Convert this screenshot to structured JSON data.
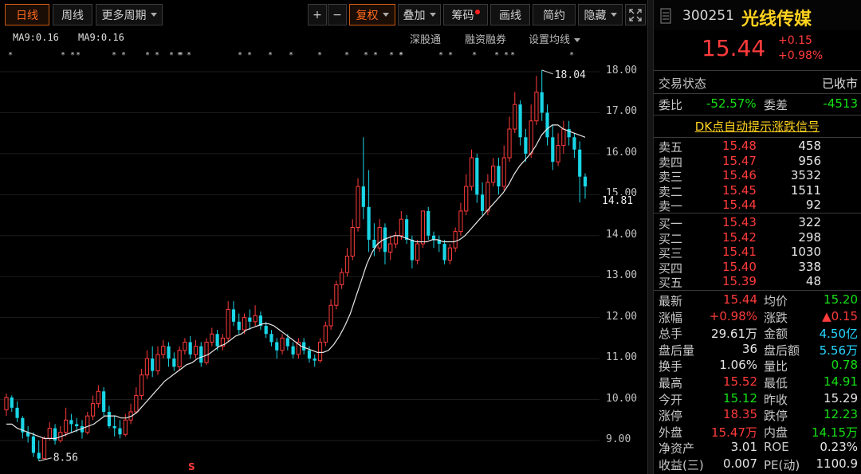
{
  "toolbar": {
    "day": "日线",
    "week": "周线",
    "more": "更多周期",
    "plus": "+",
    "minus": "−",
    "fuquan": "复权",
    "overlay": "叠加",
    "chip": "筹码",
    "draw": "画线",
    "simple": "简约",
    "hide": "隐藏",
    "fullscreen_icon": "fullscreen-icon"
  },
  "ma_legend": {
    "left": "MA9:0.16",
    "right": "MA9:0.16"
  },
  "sub_toolbar": {
    "a": "深股通",
    "b": "融资融券",
    "c": "设置均线"
  },
  "stars": [
    "*",
    "* *",
    "*",
    "* *",
    "* *",
    "* *",
    "* *",
    "* *",
    "*",
    "*",
    "*",
    "*",
    "* *",
    "* *",
    "*",
    "* *",
    "*",
    "* *",
    "*",
    "*"
  ],
  "chart_data": {
    "type": "candlestick",
    "y_ticks": [
      "18.00",
      "17.00",
      "16.00",
      "15.00",
      "14.00",
      "13.00",
      "12.00",
      "11.00",
      "10.00",
      "9.00"
    ],
    "ylim": [
      8.4,
      18.35
    ],
    "price_marker": "14.81",
    "annotations": {
      "high_label": "18.04",
      "low_label": "8.56",
      "signal": "S"
    },
    "candles": [
      [
        9.75,
        10.05,
        9.6,
        10.15
      ],
      [
        10.05,
        9.8,
        9.7,
        10.1
      ],
      [
        9.8,
        9.55,
        9.45,
        9.95
      ],
      [
        9.55,
        9.2,
        9.05,
        9.6
      ],
      [
        9.2,
        9.1,
        8.95,
        9.35
      ],
      [
        9.1,
        8.7,
        8.6,
        9.2
      ],
      [
        8.7,
        8.56,
        8.5,
        9.0
      ],
      [
        8.56,
        9.05,
        8.55,
        9.1
      ],
      [
        9.05,
        9.3,
        9.0,
        9.45
      ],
      [
        9.3,
        9.0,
        8.9,
        9.4
      ],
      [
        9.0,
        9.2,
        8.95,
        9.35
      ],
      [
        9.2,
        9.5,
        9.1,
        9.8
      ],
      [
        9.5,
        9.4,
        9.2,
        9.65
      ],
      [
        9.4,
        9.35,
        9.2,
        9.55
      ],
      [
        9.35,
        9.2,
        9.05,
        9.5
      ],
      [
        9.2,
        9.6,
        9.15,
        9.7
      ],
      [
        9.6,
        9.9,
        9.5,
        10.1
      ],
      [
        9.9,
        10.2,
        9.8,
        10.35
      ],
      [
        10.2,
        9.7,
        9.6,
        10.3
      ],
      [
        9.7,
        9.35,
        9.3,
        9.85
      ],
      [
        9.35,
        9.3,
        9.1,
        9.6
      ],
      [
        9.3,
        9.15,
        9.05,
        9.5
      ],
      [
        9.15,
        9.5,
        9.1,
        9.65
      ],
      [
        9.5,
        9.7,
        9.4,
        9.9
      ],
      [
        9.7,
        10.1,
        9.65,
        10.3
      ],
      [
        10.1,
        10.6,
        10.0,
        10.75
      ],
      [
        10.6,
        11.0,
        10.5,
        11.2
      ],
      [
        11.0,
        10.7,
        10.55,
        11.3
      ],
      [
        10.7,
        11.1,
        10.6,
        11.3
      ],
      [
        11.1,
        11.3,
        11.0,
        11.45
      ],
      [
        11.3,
        11.0,
        10.8,
        11.4
      ],
      [
        11.0,
        10.8,
        10.7,
        11.15
      ],
      [
        10.8,
        11.2,
        10.7,
        11.3
      ],
      [
        11.2,
        11.4,
        11.1,
        11.5
      ],
      [
        11.4,
        11.1,
        11.0,
        11.55
      ],
      [
        11.1,
        11.3,
        11.0,
        11.45
      ],
      [
        11.3,
        10.9,
        10.8,
        11.4
      ],
      [
        10.9,
        11.4,
        10.85,
        11.5
      ],
      [
        11.4,
        11.6,
        11.3,
        11.75
      ],
      [
        11.6,
        11.3,
        11.2,
        11.7
      ],
      [
        11.3,
        11.5,
        11.2,
        11.6
      ],
      [
        11.5,
        12.2,
        11.4,
        12.4
      ],
      [
        12.2,
        11.9,
        11.8,
        12.4
      ],
      [
        11.9,
        11.7,
        11.6,
        12.1
      ],
      [
        11.7,
        12.0,
        11.6,
        12.1
      ],
      [
        12.0,
        11.9,
        11.7,
        12.2
      ],
      [
        11.9,
        12.05,
        11.8,
        12.3
      ],
      [
        12.05,
        11.8,
        11.7,
        12.15
      ],
      [
        11.8,
        11.6,
        11.5,
        11.9
      ],
      [
        11.6,
        11.4,
        11.3,
        11.7
      ],
      [
        11.4,
        11.2,
        11.0,
        11.5
      ],
      [
        11.2,
        11.5,
        11.1,
        11.6
      ],
      [
        11.5,
        11.3,
        11.2,
        11.6
      ],
      [
        11.3,
        11.1,
        11.0,
        11.4
      ],
      [
        11.1,
        11.4,
        11.0,
        11.5
      ],
      [
        11.4,
        11.2,
        11.1,
        11.5
      ],
      [
        11.2,
        11.0,
        10.9,
        11.3
      ],
      [
        11.0,
        10.95,
        10.8,
        11.1
      ],
      [
        10.95,
        11.4,
        10.9,
        11.5
      ],
      [
        11.4,
        11.8,
        11.3,
        11.9
      ],
      [
        11.8,
        12.3,
        11.7,
        12.45
      ],
      [
        12.3,
        12.8,
        12.2,
        12.9
      ],
      [
        12.8,
        13.1,
        12.7,
        13.2
      ],
      [
        13.1,
        13.5,
        13.0,
        13.7
      ],
      [
        13.5,
        14.2,
        13.4,
        14.4
      ],
      [
        14.2,
        15.2,
        14.1,
        15.4
      ],
      [
        15.2,
        14.7,
        14.4,
        16.4
      ],
      [
        14.7,
        13.9,
        13.6,
        15.6
      ],
      [
        13.9,
        13.7,
        13.5,
        14.3
      ],
      [
        13.7,
        14.2,
        13.6,
        14.4
      ],
      [
        14.2,
        13.6,
        13.3,
        14.3
      ],
      [
        13.6,
        13.8,
        13.4,
        14.0
      ],
      [
        13.8,
        14.0,
        13.7,
        14.1
      ],
      [
        14.0,
        14.4,
        13.9,
        14.6
      ],
      [
        14.4,
        13.9,
        13.8,
        14.5
      ],
      [
        13.9,
        13.4,
        13.2,
        14.0
      ],
      [
        13.4,
        13.8,
        13.3,
        13.9
      ],
      [
        13.8,
        14.6,
        13.7,
        14.6
      ],
      [
        14.6,
        14.0,
        13.9,
        14.7
      ],
      [
        14.0,
        13.9,
        13.7,
        14.1
      ],
      [
        13.9,
        13.8,
        13.6,
        14.0
      ],
      [
        13.8,
        13.4,
        13.3,
        13.9
      ],
      [
        13.4,
        13.7,
        13.3,
        13.8
      ],
      [
        13.7,
        14.1,
        13.6,
        14.2
      ],
      [
        14.1,
        14.6,
        14.0,
        14.8
      ],
      [
        14.6,
        15.2,
        14.5,
        15.5
      ],
      [
        15.2,
        15.9,
        15.1,
        16.1
      ],
      [
        15.9,
        15.0,
        14.8,
        16.0
      ],
      [
        15.0,
        14.6,
        14.5,
        15.3
      ],
      [
        14.6,
        15.3,
        14.5,
        15.5
      ],
      [
        15.3,
        15.7,
        15.2,
        15.9
      ],
      [
        15.7,
        15.2,
        15.0,
        15.9
      ],
      [
        15.2,
        15.9,
        15.1,
        16.2
      ],
      [
        15.9,
        16.6,
        15.8,
        16.9
      ],
      [
        16.6,
        17.2,
        16.5,
        17.5
      ],
      [
        17.2,
        16.4,
        16.2,
        17.3
      ],
      [
        16.4,
        16.0,
        15.8,
        16.6
      ],
      [
        16.0,
        16.8,
        15.9,
        17.2
      ],
      [
        16.8,
        17.5,
        16.7,
        17.9
      ],
      [
        17.5,
        17.0,
        16.8,
        18.04
      ],
      [
        17.0,
        16.4,
        16.2,
        17.2
      ],
      [
        16.4,
        15.8,
        15.6,
        16.7
      ],
      [
        15.8,
        16.2,
        15.7,
        16.5
      ],
      [
        16.2,
        16.6,
        16.0,
        16.8
      ],
      [
        16.6,
        16.4,
        16.2,
        16.8
      ],
      [
        16.4,
        16.1,
        15.9,
        16.5
      ],
      [
        16.1,
        15.44,
        14.81,
        16.3
      ],
      [
        15.44,
        15.2,
        14.9,
        15.52
      ]
    ],
    "ma_line": [
      9.4,
      9.4,
      9.3,
      9.25,
      9.2,
      9.15,
      9.1,
      9.05,
      9.05,
      9.05,
      9.1,
      9.15,
      9.2,
      9.25,
      9.3,
      9.35,
      9.4,
      9.5,
      9.6,
      9.6,
      9.6,
      9.55,
      9.55,
      9.6,
      9.7,
      9.85,
      10.0,
      10.15,
      10.3,
      10.45,
      10.55,
      10.65,
      10.75,
      10.85,
      10.9,
      11.0,
      11.05,
      11.1,
      11.2,
      11.3,
      11.35,
      11.45,
      11.55,
      11.6,
      11.7,
      11.75,
      11.8,
      11.85,
      11.85,
      11.8,
      11.7,
      11.6,
      11.5,
      11.4,
      11.3,
      11.25,
      11.2,
      11.15,
      11.15,
      11.2,
      11.35,
      11.55,
      11.8,
      12.1,
      12.5,
      12.9,
      13.3,
      13.6,
      13.8,
      13.9,
      13.95,
      14.0,
      14.0,
      13.95,
      13.9,
      13.85,
      13.85,
      13.85,
      13.9,
      13.9,
      13.85,
      13.85,
      13.85,
      13.9,
      14.0,
      14.15,
      14.3,
      14.45,
      14.6,
      14.75,
      14.9,
      15.05,
      15.25,
      15.5,
      15.7,
      15.85,
      16.0,
      16.2,
      16.45,
      16.6,
      16.7,
      16.7,
      16.6,
      16.55,
      16.5,
      16.45,
      16.4
    ]
  },
  "panel": {
    "code": "300251",
    "name": "光线传媒",
    "price": "15.44",
    "change": "+0.15",
    "pct": "+0.98%",
    "status_label": "交易状态",
    "status_value": "已收市",
    "weibi_label": "委比",
    "weibi_value": "-52.57%",
    "weicha_label": "委差",
    "weicha_value": "-4513",
    "dk_link": "DK点自动提示涨跌信号",
    "asks": [
      {
        "label": "卖五",
        "price": "15.48",
        "vol": "458"
      },
      {
        "label": "卖四",
        "price": "15.47",
        "vol": "956"
      },
      {
        "label": "卖三",
        "price": "15.46",
        "vol": "3532"
      },
      {
        "label": "卖二",
        "price": "15.45",
        "vol": "1511"
      },
      {
        "label": "卖一",
        "price": "15.44",
        "vol": "92"
      }
    ],
    "bids": [
      {
        "label": "买一",
        "price": "15.43",
        "vol": "322"
      },
      {
        "label": "买二",
        "price": "15.42",
        "vol": "298"
      },
      {
        "label": "买三",
        "price": "15.41",
        "vol": "1030"
      },
      {
        "label": "买四",
        "price": "15.40",
        "vol": "338"
      },
      {
        "label": "买五",
        "price": "15.39",
        "vol": "48"
      }
    ],
    "stats": [
      {
        "l1": "最新",
        "v1": "15.44",
        "c1": "red",
        "l2": "均价",
        "v2": "15.20",
        "c2": "green"
      },
      {
        "l1": "涨幅",
        "v1": "+0.98%",
        "c1": "red",
        "l2": "涨跌",
        "v2": "▲0.15",
        "c2": "red"
      },
      {
        "l1": "总手",
        "v1": "29.61万",
        "c1": "white",
        "l2": "金额",
        "v2": "4.50亿",
        "c2": "cyan"
      },
      {
        "l1": "盘后量",
        "v1": "36",
        "c1": "white",
        "l2": "盘后额",
        "v2": "5.56万",
        "c2": "cyan"
      },
      {
        "l1": "换手",
        "v1": "1.06%",
        "c1": "white",
        "l2": "量比",
        "v2": "0.78",
        "c2": "green"
      },
      {
        "l1": "最高",
        "v1": "15.52",
        "c1": "red",
        "l2": "最低",
        "v2": "14.91",
        "c2": "green"
      },
      {
        "l1": "今开",
        "v1": "15.12",
        "c1": "green",
        "l2": "昨收",
        "v2": "15.29",
        "c2": "white"
      },
      {
        "l1": "涨停",
        "v1": "18.35",
        "c1": "red",
        "l2": "跌停",
        "v2": "12.23",
        "c2": "green"
      },
      {
        "l1": "外盘",
        "v1": "15.47万",
        "c1": "red",
        "l2": "内盘",
        "v2": "14.15万",
        "c2": "green"
      },
      {
        "l1": "净资产",
        "v1": "3.01",
        "c1": "white",
        "l2": "ROE",
        "v2": "0.23%",
        "c2": "white"
      },
      {
        "l1": "收益(三)",
        "v1": "0.007",
        "c1": "white",
        "l2": "PE(动)",
        "v2": "1100.9",
        "c2": "white"
      }
    ]
  },
  "colors": {
    "up": "#ff3b3b",
    "down": "#19d6e6",
    "ma": "#e8e8e8",
    "accent": "#ff6a1e"
  }
}
